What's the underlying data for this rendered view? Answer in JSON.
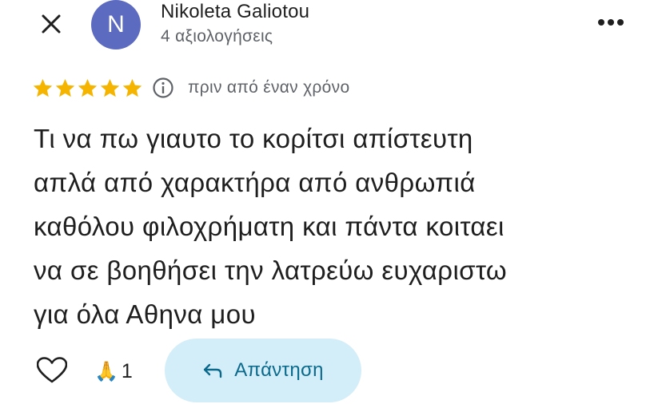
{
  "header": {
    "close_icon": "close-icon",
    "avatar_initial": "N",
    "avatar_color": "#5c6bc0",
    "author_name": "Nikoleta Galiotou",
    "author_meta": "4 αξιολογήσεις",
    "more_icon": "more-vert-icon"
  },
  "rating": {
    "stars": 5,
    "star_color": "#f5b400",
    "time_ago": "πριν από έναν χρόνο"
  },
  "review": {
    "lines": [
      "Τι να πω γιαυτο το κορίτσι απίστευτη",
      "απλά από χαρακτήρα από ανθρωπιά",
      "καθόλου φιλοχρήματη και πάντα κοιταει",
      "να σε βοηθήσει την λατρεύω ευχαριστω",
      "για όλα Αθηνα μου"
    ]
  },
  "actions": {
    "reaction_emoji": "🙏",
    "reaction_count": "1",
    "reply_label": "Απάντηση",
    "reply_bg": "#d3eef8",
    "reply_color": "#0b6a8c"
  }
}
